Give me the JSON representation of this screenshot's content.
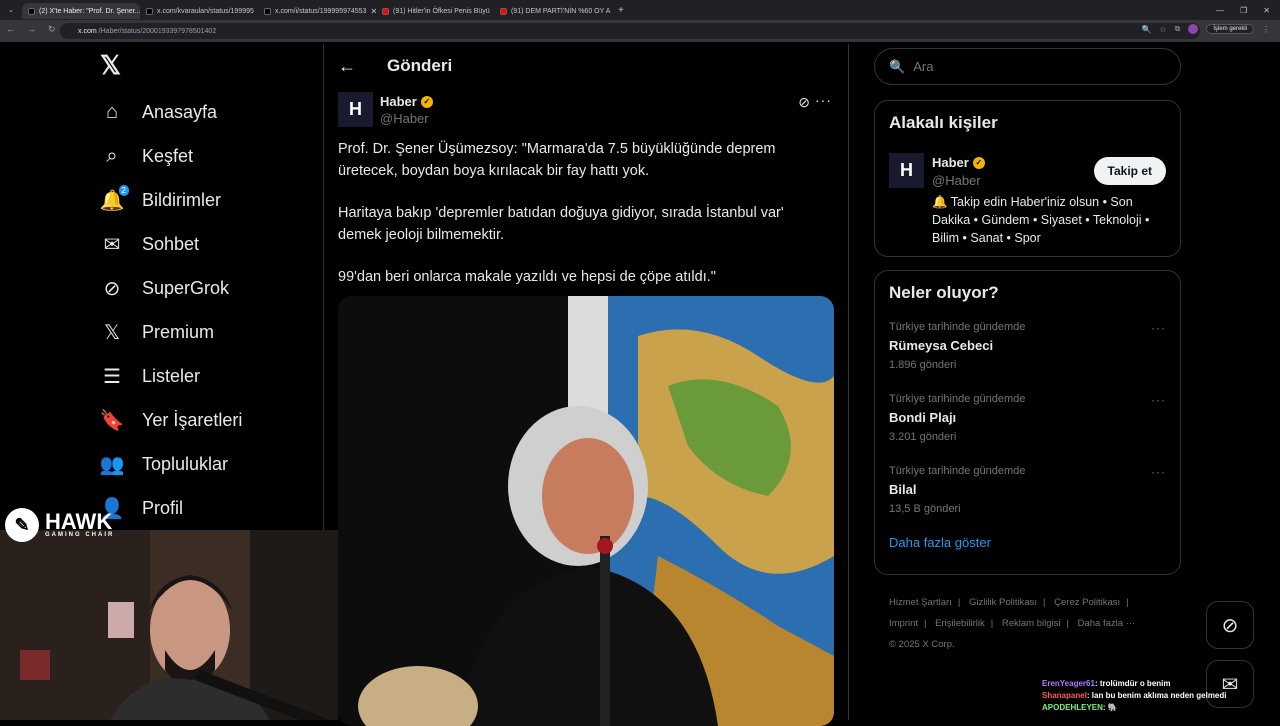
{
  "browser": {
    "tabs": [
      {
        "title": "(2) X'te Haber: \"Prof. Dr. Şener...",
        "active": true,
        "fav": "x"
      },
      {
        "title": "x.com/kvaraulan/status/199995",
        "active": false,
        "fav": "x"
      },
      {
        "title": "x.com/i/status/199995974553",
        "active": false,
        "fav": "x"
      },
      {
        "title": "(91) Hitler'in Öfkesi Penis Büyü",
        "active": false,
        "fav": "yt"
      },
      {
        "title": "(91) DEM PARTİ'NİN %60 OY A",
        "active": false,
        "fav": "yt"
      }
    ],
    "url_domain": "x.com",
    "url_path": "/Haber/status/2000193397978501402",
    "update_pill": "İşlem gerekli"
  },
  "nav": {
    "items": [
      {
        "label": "Anasayfa",
        "icon": "home-icon"
      },
      {
        "label": "Keşfet",
        "icon": "search-icon"
      },
      {
        "label": "Bildirimler",
        "icon": "bell-icon",
        "badge": "2"
      },
      {
        "label": "Sohbet",
        "icon": "mail-icon"
      },
      {
        "label": "SuperGrok",
        "icon": "grok-icon"
      },
      {
        "label": "Premium",
        "icon": "x-icon"
      },
      {
        "label": "Listeler",
        "icon": "list-icon"
      },
      {
        "label": "Yer İşaretleri",
        "icon": "bookmark-icon"
      },
      {
        "label": "Topluluklar",
        "icon": "people-icon"
      },
      {
        "label": "Profil",
        "icon": "person-icon"
      }
    ]
  },
  "post": {
    "header_title": "Gönderi",
    "author_name": "Haber",
    "author_handle": "@Haber",
    "avatar_letter": "H",
    "paragraphs": [
      "Prof. Dr. Şener Üşümezsoy: \"Marmara'da 7.5 büyüklüğünde deprem üretecek, boydan boya kırılacak bir fay hattı yok.",
      "Haritaya bakıp 'depremler batıdan doğuya gidiyor, sırada İstanbul var' demek jeoloji bilmemektir.",
      "99'dan beri onlarca makale yazıldı ve hepsi de çöpe atıldı.\""
    ]
  },
  "search": {
    "placeholder": "Ara"
  },
  "related": {
    "title": "Alakalı kişiler",
    "name": "Haber",
    "handle": "@Haber",
    "follow_label": "Takip et",
    "bio": "🔔 Takip edin Haber'iniz olsun • Son Dakika • Gündem • Siyaset • Teknoloji • Bilim • Sanat • Spor"
  },
  "trends": {
    "title": "Neler oluyor?",
    "items": [
      {
        "category": "Türkiye tarihinde gündemde",
        "name": "Rümeysa Cebeci",
        "count": "1.896 gönderi"
      },
      {
        "category": "Türkiye tarihinde gündemde",
        "name": "Bondi Plajı",
        "count": "3.201 gönderi"
      },
      {
        "category": "Türkiye tarihinde gündemde",
        "name": "Bilal",
        "count": "13,5 B gönderi"
      }
    ],
    "show_more": "Daha fazla göster"
  },
  "footer": {
    "links": [
      "Hizmet Şartları",
      "Gizlilik Politikası",
      "Çerez Politikası",
      "Imprint",
      "Erişilebilirlik",
      "Reklam bilgisi",
      "Daha fazla ···"
    ],
    "copyright": "© 2025 X Corp."
  },
  "overlay": {
    "logo_text": "HAWK",
    "logo_sub": "GAMING CHAIR",
    "chat": [
      {
        "user": "ErenYeager61",
        "msg": ": trolümdür o benim",
        "color": "#b07cff"
      },
      {
        "user": "Shanapanel",
        "msg": ": lan bu benim aklıma neden gelmedi",
        "color": "#ff5a5a"
      },
      {
        "user": "APODEHLEYEN",
        "msg": ": 🐘",
        "color": "#7cf27c"
      }
    ]
  }
}
